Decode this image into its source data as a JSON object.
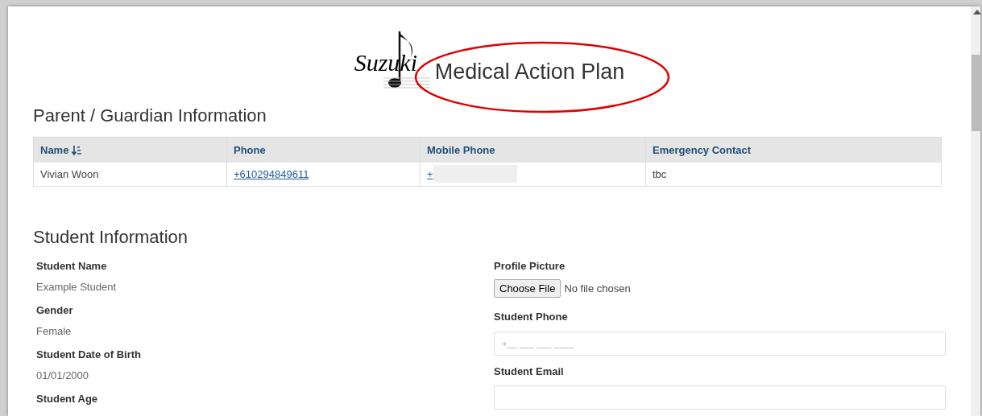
{
  "header": {
    "logo_text": "Suzuki",
    "title": "Medical Action Plan",
    "annotated": true
  },
  "guardian": {
    "heading": "Parent / Guardian Information",
    "columns": [
      {
        "label": "Name",
        "sorted": true
      },
      {
        "label": "Phone",
        "sorted": false
      },
      {
        "label": "Mobile Phone",
        "sorted": false
      },
      {
        "label": "Emergency Contact",
        "sorted": false
      }
    ],
    "rows": [
      {
        "name": "Vivian Woon",
        "phone": "+610294849611",
        "mobile": "+",
        "mobile_redacted": true,
        "emergency_contact": "tbc"
      }
    ]
  },
  "student": {
    "heading": "Student Information",
    "left": [
      {
        "label": "Student Name",
        "value": "Example Student"
      },
      {
        "label": "Gender",
        "value": "Female"
      },
      {
        "label": "Student Date of Birth",
        "value": "01/01/2000"
      },
      {
        "label": "Student Age"
      }
    ],
    "profile_picture": {
      "label": "Profile Picture",
      "button": "Choose File",
      "status": "No file chosen"
    },
    "fields": [
      {
        "label": "Student Phone",
        "placeholder": "+__ ___ ___ ____"
      },
      {
        "label": "Student Email"
      }
    ]
  }
}
